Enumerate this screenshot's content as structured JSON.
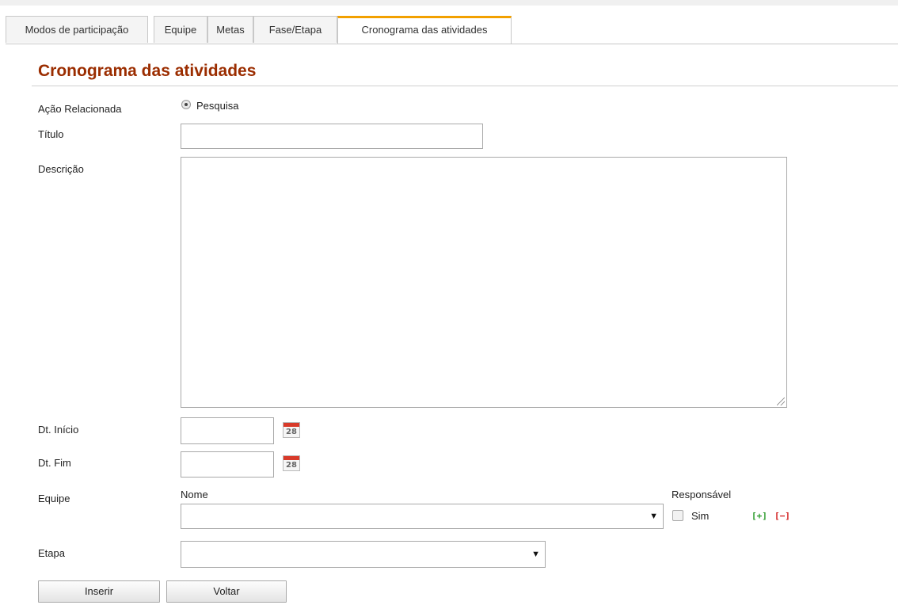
{
  "tabs": [
    {
      "label": "Modos de participação"
    },
    {
      "label": "Equipe"
    },
    {
      "label": "Metas"
    },
    {
      "label": "Fase/Etapa"
    },
    {
      "label": "Cronograma das atividades"
    }
  ],
  "section_title": "Cronograma das atividades",
  "form": {
    "acao_relacionada": {
      "label": "Ação Relacionada",
      "option": "Pesquisa",
      "selected": true
    },
    "titulo": {
      "label": "Título",
      "value": ""
    },
    "descricao": {
      "label": "Descrição",
      "value": ""
    },
    "dt_inicio": {
      "label": "Dt. Início",
      "value": "",
      "calendar_day": "28"
    },
    "dt_fim": {
      "label": "Dt. Fim",
      "value": "",
      "calendar_day": "28"
    },
    "equipe": {
      "label": "Equipe",
      "nome_header": "Nome",
      "responsavel_header": "Responsável",
      "sim_label": "Sim",
      "add_icon": "[+]",
      "remove_icon": "[−]",
      "selected": ""
    },
    "etapa": {
      "label": "Etapa",
      "selected": ""
    }
  },
  "buttons": {
    "inserir": "Inserir",
    "voltar": "Voltar"
  },
  "colors": {
    "title": "#9b2d00",
    "active_tab": "#f2a000",
    "add": "#2a9a2a",
    "remove": "#d32020"
  }
}
